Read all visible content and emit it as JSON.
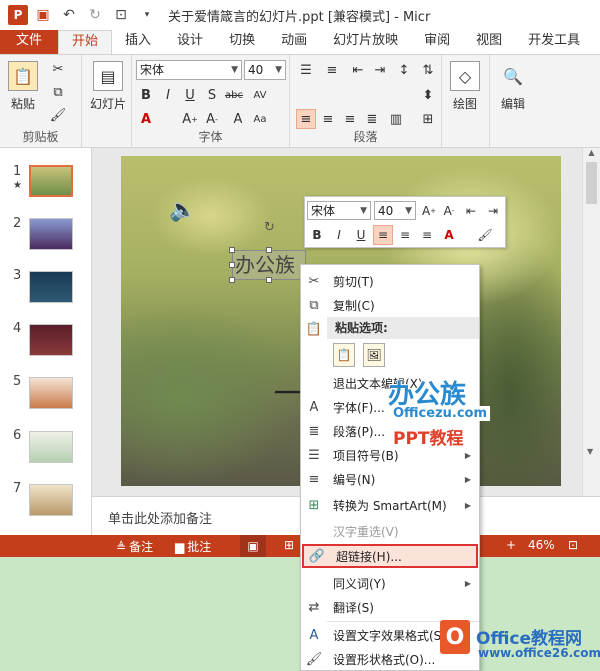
{
  "window": {
    "title": "关于爱情箴言的幻灯片.ppt [兼容模式] - Micr",
    "app_logo": "P",
    "colors": {
      "accent": "#c43e1c",
      "status_bar": "#c43e1c",
      "highlight_border": "#dd3333"
    }
  },
  "tabs": [
    {
      "label": "文件"
    },
    {
      "label": "开始"
    },
    {
      "label": "插入"
    },
    {
      "label": "设计"
    },
    {
      "label": "切换"
    },
    {
      "label": "动画"
    },
    {
      "label": "幻灯片放映"
    },
    {
      "label": "审阅"
    },
    {
      "label": "视图"
    },
    {
      "label": "开发工具"
    }
  ],
  "ribbon": {
    "clipboard": {
      "group_label": "剪贴板",
      "paste_label": "粘贴"
    },
    "slides": {
      "new_slide_label": "幻灯片"
    },
    "font": {
      "group_label": "字体",
      "font_name": "宋体",
      "font_size": "40"
    },
    "paragraph": {
      "group_label": "段落"
    },
    "drawing": {
      "label": "绘图"
    },
    "editing": {
      "label": "编辑"
    }
  },
  "thumbnails": [
    {
      "number": "1",
      "star": "★"
    },
    {
      "number": "2"
    },
    {
      "number": "3"
    },
    {
      "number": "4"
    },
    {
      "number": "5"
    },
    {
      "number": "6"
    },
    {
      "number": "7"
    }
  ],
  "slide": {
    "textbox_text": "办公族"
  },
  "notes": {
    "placeholder": "单击此处添加备注"
  },
  "status_bar": {
    "notes_label": "备注",
    "comments_label": "批注",
    "zoom": "46%"
  },
  "mini_toolbar": {
    "font_name": "宋体",
    "font_size": "40"
  },
  "context_menu": {
    "cut": "剪切(T)",
    "copy": "复制(C)",
    "paste_options_header": "粘贴选项:",
    "exit_edit": "退出文本编辑(X)",
    "font": "字体(F)...",
    "paragraph": "段落(P)...",
    "bullets": "项目符号(B)",
    "numbering": "编号(N)",
    "smartart": "转换为 SmartArt(M)",
    "hanzi": "汉字重选(V)",
    "hyperlink": "超链接(H)...",
    "synonyms": "同义词(Y)",
    "translate": "翻译(S)",
    "text_effects": "设置文字效果格式(S)...",
    "shape_format": "设置形状格式(O)..."
  },
  "watermarks": {
    "site1_name": "办公族",
    "site1_url": "Officezu.com",
    "site1_tag": "PPT教程",
    "site2_name": "Office教程网",
    "site2_url": "www.office26.com"
  }
}
